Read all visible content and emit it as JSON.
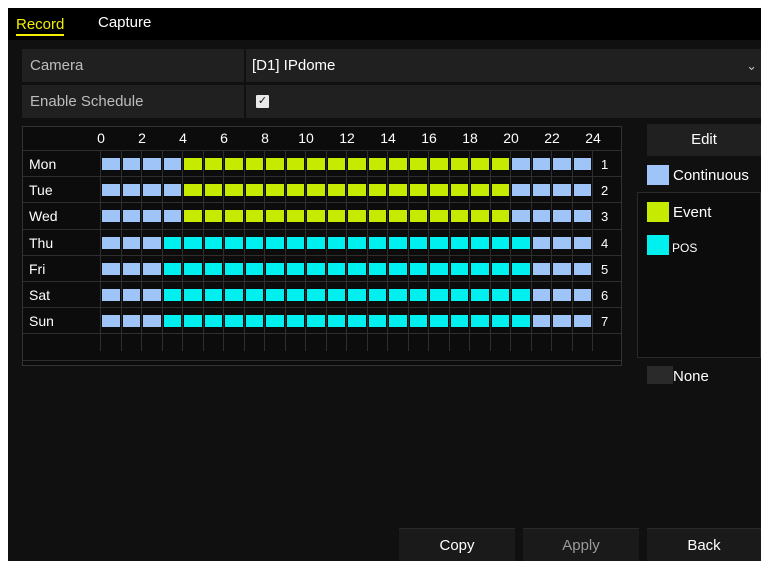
{
  "tabs": [
    {
      "label": "Record",
      "active": true
    },
    {
      "label": "Capture",
      "active": false
    }
  ],
  "camera": {
    "label": "Camera",
    "value": "[D1] IPdome"
  },
  "enable_schedule": {
    "label": "Enable Schedule",
    "checked": true
  },
  "schedule": {
    "hour_labels": [
      "0",
      "2",
      "4",
      "6",
      "8",
      "10",
      "12",
      "14",
      "16",
      "18",
      "20",
      "22",
      "24"
    ],
    "days": [
      {
        "label": "Mon",
        "num": "1",
        "segments": [
          {
            "start": 0,
            "end": 4,
            "type": "continuous"
          },
          {
            "start": 4,
            "end": 20,
            "type": "event"
          },
          {
            "start": 20,
            "end": 24,
            "type": "continuous"
          }
        ]
      },
      {
        "label": "Tue",
        "num": "2",
        "segments": [
          {
            "start": 0,
            "end": 4,
            "type": "continuous"
          },
          {
            "start": 4,
            "end": 20,
            "type": "event"
          },
          {
            "start": 20,
            "end": 24,
            "type": "continuous"
          }
        ]
      },
      {
        "label": "Wed",
        "num": "3",
        "segments": [
          {
            "start": 0,
            "end": 4,
            "type": "continuous"
          },
          {
            "start": 4,
            "end": 20,
            "type": "event"
          },
          {
            "start": 20,
            "end": 24,
            "type": "continuous"
          }
        ]
      },
      {
        "label": "Thu",
        "num": "4",
        "segments": [
          {
            "start": 0,
            "end": 3,
            "type": "continuous"
          },
          {
            "start": 3,
            "end": 21,
            "type": "pos"
          },
          {
            "start": 21,
            "end": 24,
            "type": "continuous"
          }
        ]
      },
      {
        "label": "Fri",
        "num": "5",
        "segments": [
          {
            "start": 0,
            "end": 3,
            "type": "continuous"
          },
          {
            "start": 3,
            "end": 21,
            "type": "pos"
          },
          {
            "start": 21,
            "end": 24,
            "type": "continuous"
          }
        ]
      },
      {
        "label": "Sat",
        "num": "6",
        "segments": [
          {
            "start": 0,
            "end": 3,
            "type": "continuous"
          },
          {
            "start": 3,
            "end": 21,
            "type": "pos"
          },
          {
            "start": 21,
            "end": 24,
            "type": "continuous"
          }
        ]
      },
      {
        "label": "Sun",
        "num": "7",
        "segments": [
          {
            "start": 0,
            "end": 3,
            "type": "continuous"
          },
          {
            "start": 3,
            "end": 21,
            "type": "pos"
          },
          {
            "start": 21,
            "end": 24,
            "type": "continuous"
          }
        ]
      }
    ]
  },
  "edit_label": "Edit",
  "legend": [
    {
      "key": "continuous",
      "label": "Continuous",
      "color": "#9ec4f8"
    },
    {
      "key": "event",
      "label": "Event",
      "color": "#c6ea00"
    },
    {
      "key": "pos",
      "label": "POS",
      "color": "#00f0f0"
    }
  ],
  "none_label": "None",
  "buttons": {
    "copy": "Copy",
    "apply": "Apply",
    "back": "Back"
  },
  "colors": {
    "accent": "#f3ef00",
    "none_swatch": "#2a2a2a"
  }
}
